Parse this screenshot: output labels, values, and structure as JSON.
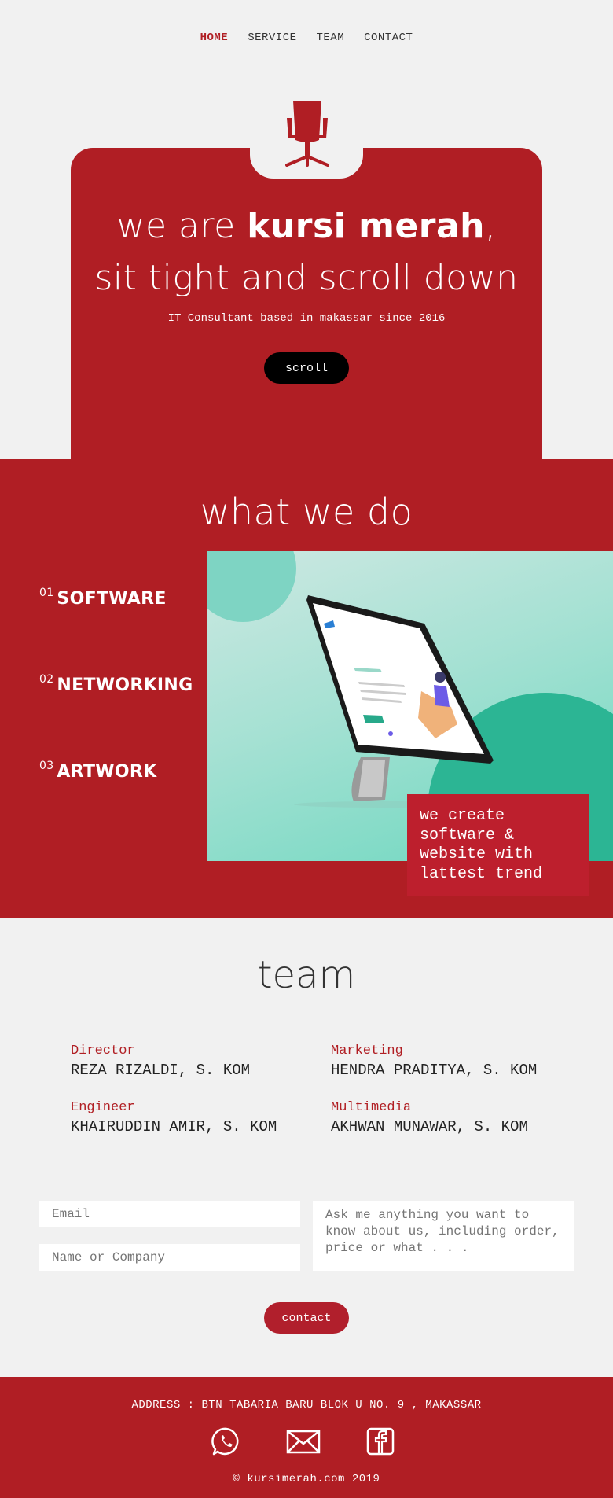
{
  "nav": {
    "items": [
      {
        "label": "HOME"
      },
      {
        "label": "SERVICE"
      },
      {
        "label": "TEAM"
      },
      {
        "label": "CONTACT"
      }
    ]
  },
  "hero": {
    "prefix": "we are ",
    "brand": "kursi merah",
    "suffix": ",",
    "line2": "sit tight and scroll down",
    "subtitle": "IT Consultant based in makassar since 2016",
    "button": "scroll"
  },
  "services": {
    "title": "what we do",
    "items": [
      {
        "num": "01",
        "label": "SOFTWARE"
      },
      {
        "num": "02",
        "label": "NETWORKING"
      },
      {
        "num": "03",
        "label": "ARTWORK"
      }
    ],
    "caption": "we create software & website with lattest trend"
  },
  "team": {
    "title": "team",
    "members": [
      {
        "role": "Director",
        "name": "REZA RIZALDI, S. KOM"
      },
      {
        "role": "Marketing",
        "name": "HENDRA PRADITYA, S. KOM"
      },
      {
        "role": "Engineer",
        "name": "KHAIRUDDIN AMIR, S. KOM"
      },
      {
        "role": "Multimedia",
        "name": "AKHWAN MUNAWAR, S. KOM"
      }
    ]
  },
  "contact": {
    "email_placeholder": "Email",
    "name_placeholder": "Name or Company",
    "message_placeholder": "Ask me anything you want to know about us, including order, price or what . . .",
    "button": "contact"
  },
  "footer": {
    "address": "ADDRESS : BTN TABARIA BARU BLOK U NO. 9 , MAKASSAR",
    "icons": [
      "whatsapp-icon",
      "mail-icon",
      "facebook-icon"
    ],
    "copyright": "© kursimerah.com 2019"
  },
  "colors": {
    "brand_red": "#b01e24",
    "accent_red": "#bd1f2d",
    "background": "#f1f1f1",
    "teal": "#2cb594"
  }
}
